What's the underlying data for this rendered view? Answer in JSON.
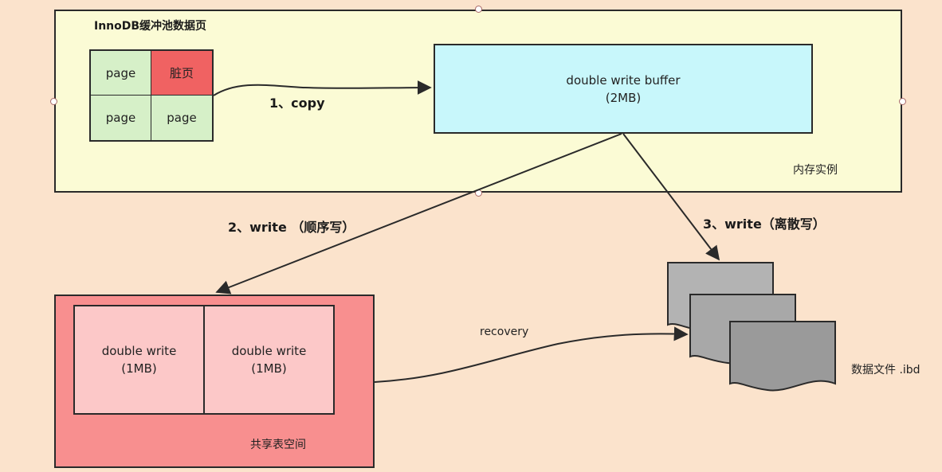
{
  "buffer_pool": {
    "title": "InnoDB缓冲池数据页",
    "pages": [
      {
        "label": "page",
        "dirty": false
      },
      {
        "label": "脏页",
        "dirty": true
      },
      {
        "label": "page",
        "dirty": false
      },
      {
        "label": "page",
        "dirty": false
      }
    ],
    "memory_label": "内存实例"
  },
  "double_write_buffer": {
    "line1": "double write buffer",
    "line2": "(2MB)"
  },
  "steps": {
    "copy": "1、copy",
    "write_seq": "2、write （顺序写）",
    "write_scatter": "3、write（离散写）",
    "recovery": "recovery"
  },
  "shared_tablespace": {
    "label": "共享表空间",
    "blocks": [
      {
        "line1": "double write",
        "line2": "(1MB)"
      },
      {
        "line1": "double write",
        "line2": "(1MB)"
      }
    ]
  },
  "data_file": {
    "label": "数据文件 .ibd"
  },
  "colors": {
    "background": "#fbe3cc",
    "memory": "#fbfbd5",
    "dirty_page": "#f06262",
    "clean_page": "#d6f0c8",
    "dwb": "#c8f7fb",
    "shared": "#f88f8f",
    "file": "#a9a9a9"
  }
}
